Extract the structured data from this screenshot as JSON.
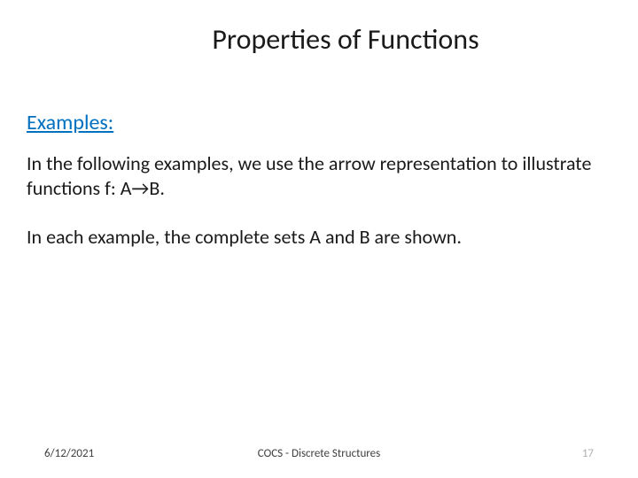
{
  "title": "Properties of Functions",
  "subtitle": "Examples:",
  "paragraph1": "In the following examples, we use the arrow representation to illustrate functions f: A→B.",
  "paragraph2": "In each example, the complete sets A and B are shown.",
  "footer": {
    "date": "6/12/2021",
    "center": "COCS - Discrete Structures",
    "page": "17"
  }
}
